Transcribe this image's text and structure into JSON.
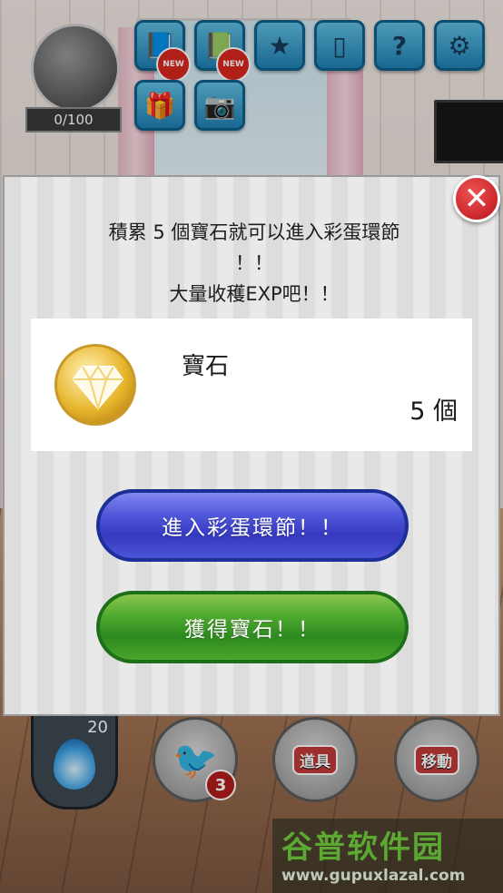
{
  "hud": {
    "exp_text": "0/100",
    "top_icons": [
      {
        "name": "book-icon",
        "badge": "NEW"
      },
      {
        "name": "book-icon",
        "badge": "NEW"
      },
      {
        "name": "chat-stars-icon",
        "badge": ""
      },
      {
        "name": "phone-icon",
        "badge": ""
      },
      {
        "name": "help-icon",
        "glyph": "?",
        "badge": ""
      },
      {
        "name": "gear-icon",
        "badge": ""
      },
      {
        "name": "gift-icon",
        "badge": ""
      },
      {
        "name": "camera-icon",
        "badge": ""
      }
    ],
    "fire_count": "20",
    "crow_count": "3",
    "items_label": "道具",
    "move_label": "移動"
  },
  "dialog": {
    "message_lines": [
      "積累 5 個寶石就可以進入彩蛋環節",
      "！！",
      "大量收穫EXP吧！！"
    ],
    "item_name": "寶石",
    "item_count": "5 個",
    "enter_button": "進入彩蛋環節！！",
    "get_button": "獲得寶石！！",
    "close_glyph": "✕"
  },
  "watermark": {
    "brand": "谷普软件园",
    "url": "www.gupuxlazal.com"
  },
  "colors": {
    "blue_button": "#4f56d8",
    "green_button": "#4ca72d",
    "close_red": "#c8202a",
    "gem_gold": "#e7b52c"
  }
}
